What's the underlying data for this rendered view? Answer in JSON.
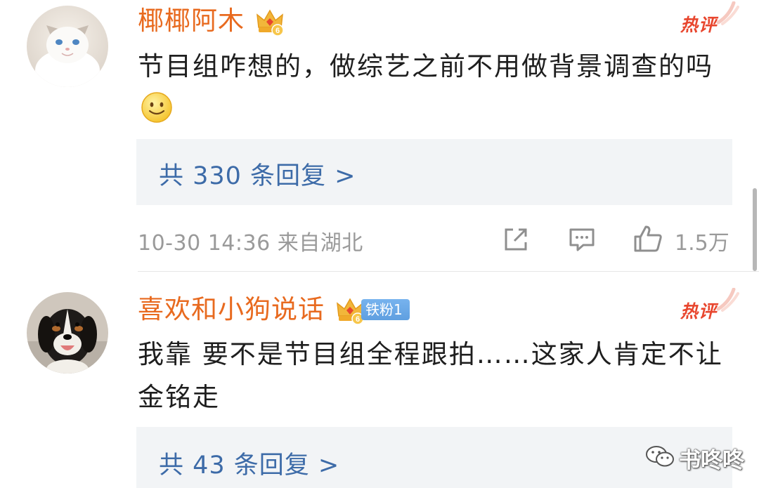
{
  "comments": [
    {
      "username": "椰椰阿木",
      "avatar": "cat-avatar",
      "level_badge": "crown-level-icon",
      "crown_level": "6",
      "hot_tag": "热评",
      "text": "节目组咋想的，做综艺之前不用做背景调查的吗",
      "emoji": "smile-emoji",
      "replies_label": "共 330 条回复 >",
      "timestamp": "10-30 14:36",
      "location": "来自湖北",
      "like_count": "1.5万"
    },
    {
      "username": "喜欢和小狗说话",
      "avatar": "dog-avatar",
      "level_badge": "crown-level-icon",
      "crown_level": "6",
      "fan_badge": "铁粉1",
      "hot_tag": "热评",
      "text": "我靠 要不是节目组全程跟拍……这家人肯定不让金铭走",
      "replies_label": "共 43 条回复 >"
    }
  ],
  "watermark": {
    "icon": "wechat-icon",
    "text": "书咚咚"
  },
  "colors": {
    "username": "#e86a1f",
    "hot_tag": "#e8462e",
    "link": "#3d6ba8",
    "meta": "#9a9a9a",
    "reply_bg": "#f2f4f6",
    "fan_badge": "#6aa8e8"
  }
}
